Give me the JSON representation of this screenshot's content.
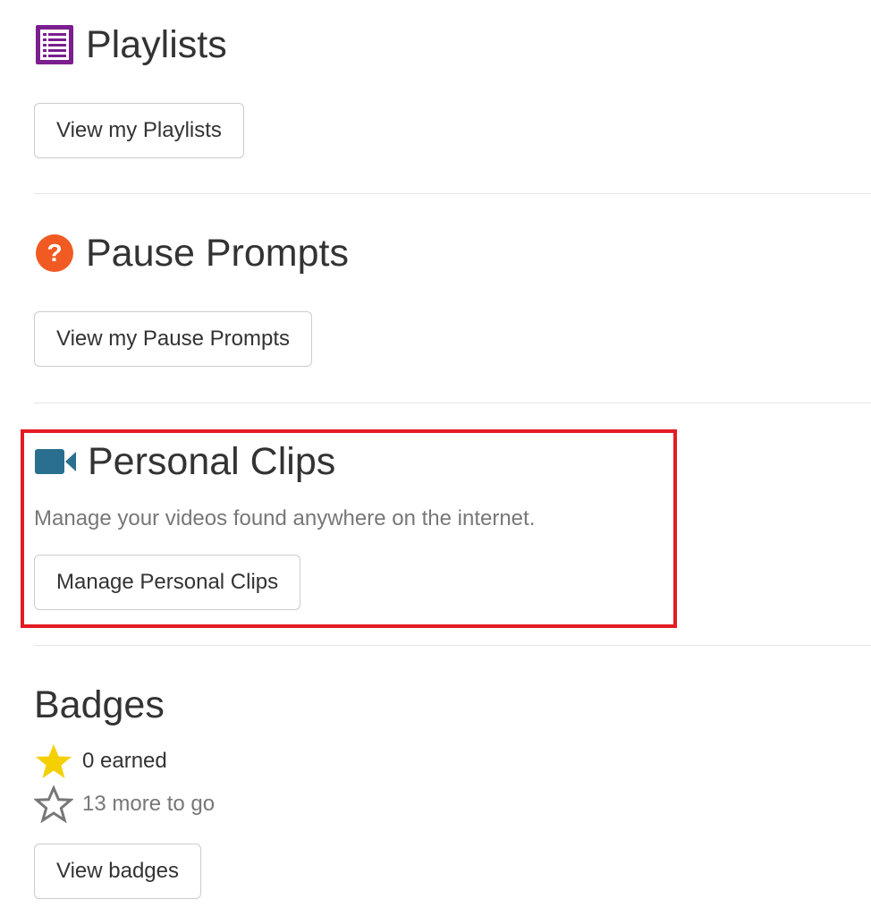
{
  "playlists": {
    "title": "Playlists",
    "button_label": "View my Playlists",
    "icon": "list-icon",
    "icon_color": "#7b1e8f"
  },
  "pause_prompts": {
    "title": "Pause Prompts",
    "button_label": "View my Pause Prompts",
    "icon": "question-circle-icon",
    "icon_color": "#f15a22"
  },
  "personal_clips": {
    "title": "Personal Clips",
    "description": "Manage your videos found anywhere on the internet.",
    "button_label": "Manage Personal Clips",
    "icon": "video-camera-icon",
    "icon_color": "#2a6f8f",
    "highlight_color": "#e31b23"
  },
  "badges": {
    "title": "Badges",
    "earned_text": "0 earned",
    "remaining_text": "13 more to go",
    "button_label": "View badges",
    "earned_icon": "star-filled-icon",
    "earned_icon_color": "#f5d000",
    "remaining_icon": "star-outline-icon",
    "remaining_icon_color": "#777777"
  }
}
